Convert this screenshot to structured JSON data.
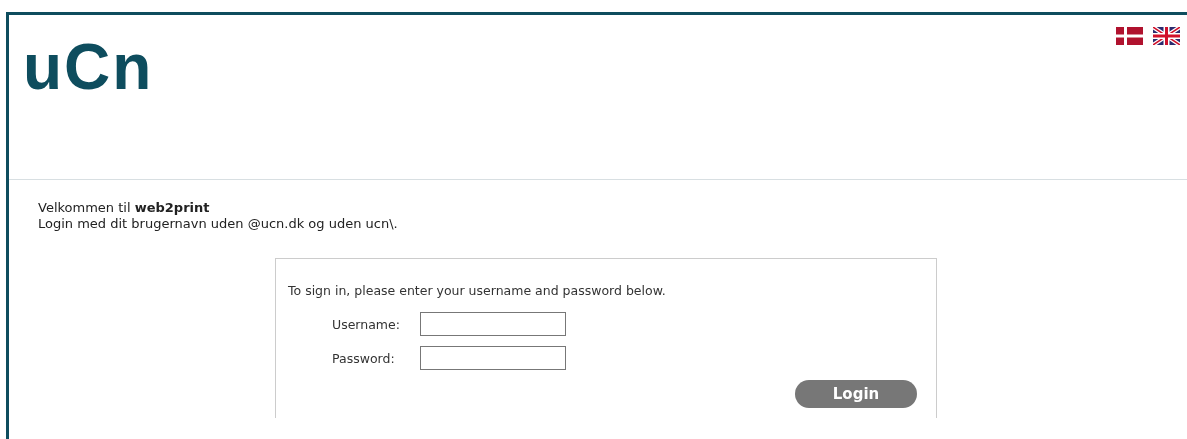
{
  "header": {
    "logo": "uCn"
  },
  "welcome": {
    "lines": [
      "Velkommen til **web2print**",
      "Login med dit brugernavn uden @ucn.dk og uden ucn\\."
    ]
  },
  "login_box": {
    "instruction": "To sign in, please enter your username and password below.",
    "fields": [
      {
        "label": "Username:"
      },
      {
        "label": "Password:"
      }
    ],
    "button": "Login"
  }
}
